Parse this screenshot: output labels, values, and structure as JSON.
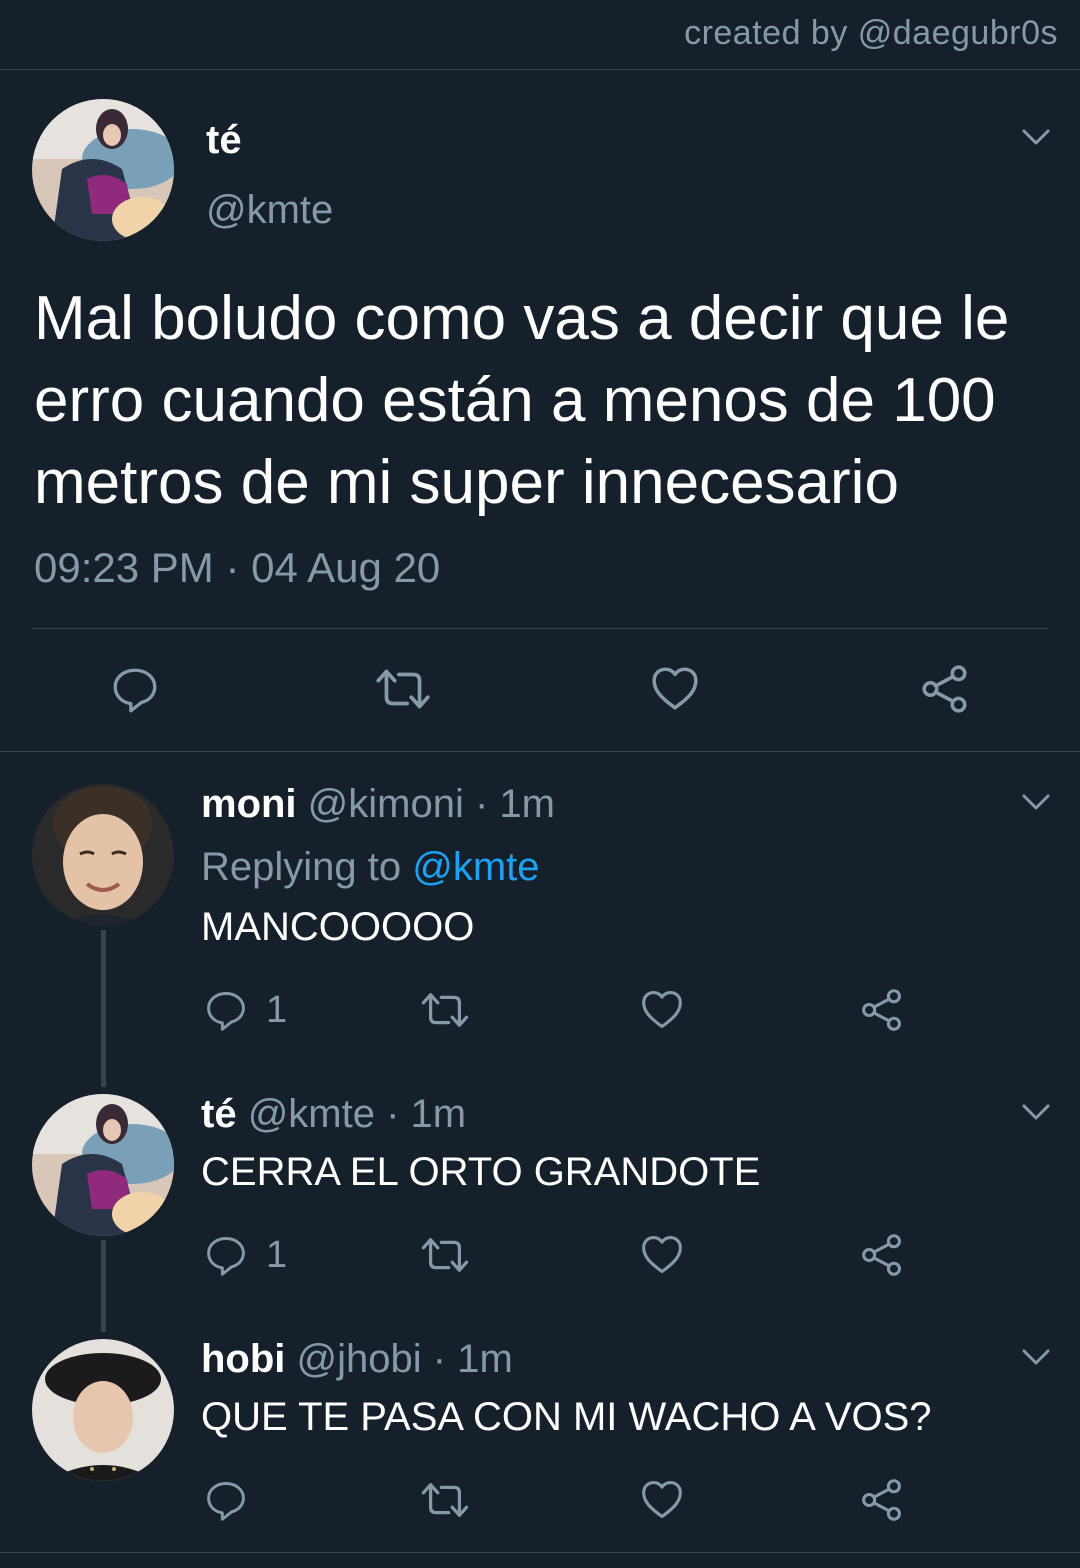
{
  "credit": "created by @daegubr0s",
  "main_tweet": {
    "name": "té",
    "handle": "@kmte",
    "text": "Mal boludo como vas a decir que le erro cuando están a menos de 100 metros de mi super innecesario",
    "timestamp": "09:23 PM · 04 Aug 20",
    "actions": [
      "reply-icon",
      "retweet-icon",
      "like-icon",
      "share-icon"
    ]
  },
  "replies": [
    {
      "name": "moni",
      "handle": "@kimoni",
      "time": "· 1m",
      "replying_label": "Replying to ",
      "replying_handle": "@kmte",
      "text": "MANCOOOOO",
      "reply_count": "1"
    },
    {
      "name": "té",
      "handle": "@kmte",
      "time": "· 1m",
      "text": "CERRA EL ORTO GRANDOTE",
      "reply_count": "1"
    },
    {
      "name": "hobi",
      "handle": "@jhobi",
      "time": "· 1m",
      "text": "QUE TE PASA CON MI WACHO A VOS?",
      "reply_count": ""
    }
  ],
  "colors": {
    "background": "#15202b",
    "secondary_text": "#8899a6",
    "link": "#1da1f2",
    "divider": "#38444d"
  }
}
